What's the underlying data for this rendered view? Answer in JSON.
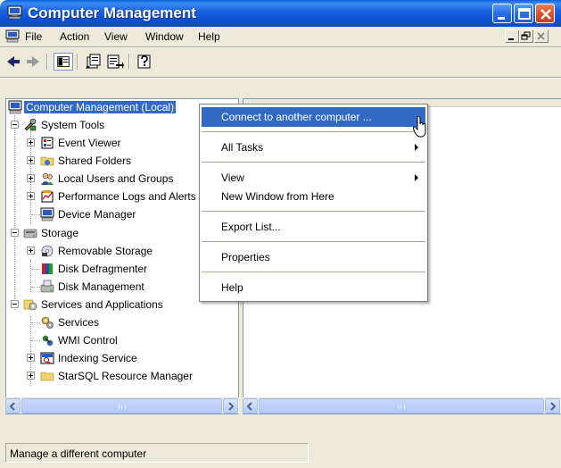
{
  "window": {
    "title": "Computer Management",
    "accent_color": "#0b4bc6"
  },
  "menubar": {
    "items": [
      "File",
      "Action",
      "View",
      "Window",
      "Help"
    ]
  },
  "toolbar": {
    "buttons": [
      "back-arrow-icon",
      "forward-arrow-icon",
      "show-hide-tree-icon",
      "properties-icon",
      "export-list-icon",
      "help-icon"
    ]
  },
  "tree": {
    "root": "Computer Management (Local)",
    "system_tools": "System Tools",
    "event_viewer": "Event Viewer",
    "shared_folders": "Shared Folders",
    "local_users": "Local Users and Groups",
    "perf_logs": "Performance Logs and Alerts",
    "device_manager": "Device Manager",
    "storage": "Storage",
    "removable_storage": "Removable Storage",
    "disk_defrag": "Disk Defragmenter",
    "disk_mgmt": "Disk Management",
    "services_apps": "Services and Applications",
    "services": "Services",
    "wmi": "WMI Control",
    "indexing": "Indexing Service",
    "starsql": "StarSQL Resource Manager"
  },
  "context_menu": {
    "connect": "Connect to another computer ...",
    "all_tasks": "All Tasks",
    "view": "View",
    "new_window": "New Window from Here",
    "export_list": "Export List...",
    "properties": "Properties",
    "help": "Help",
    "highlight_color": "#316ac5"
  },
  "status": {
    "text": "Manage a different computer"
  }
}
